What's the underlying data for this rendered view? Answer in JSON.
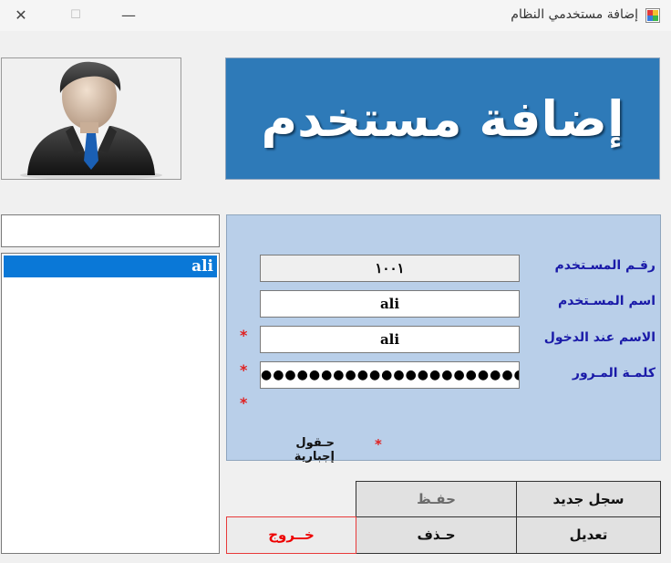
{
  "window": {
    "title": "إضافة مستخدمي النظام",
    "close_glyph": "✕",
    "maximize_glyph": "☐",
    "minimize_glyph": "—"
  },
  "header": {
    "banner_text": "إضافة مستخدم",
    "banner_color": "#2e7ab8",
    "avatar_icon": "user-avatar-icon"
  },
  "search": {
    "value": ""
  },
  "users_list": {
    "items": [
      {
        "label": "ali",
        "selected": true
      }
    ],
    "selection_color": "#0a78d7"
  },
  "form": {
    "panel_color": "#b9cfe9",
    "label_color": "#1a1aa8",
    "fields": {
      "user_id": {
        "label": "رقـم المسـتخدم",
        "value": "١٠٠١"
      },
      "user_name": {
        "label": "اسم المسـتخدم",
        "value": "ali"
      },
      "login_name": {
        "label": "الاسم عند الدخول",
        "value": "ali"
      },
      "password": {
        "label": "كلمـة المـرور",
        "value": "●●●●●●●●●●●●●●●●●●●●●●●●●●"
      }
    },
    "required_marker": "*",
    "required_color": "#e02020",
    "required_legend": "حـقول إجبارية"
  },
  "buttons": {
    "new": "سجل جديد",
    "save": "حفـظ",
    "edit": "تعديل",
    "delete": "حـذف",
    "exit": "خــروج",
    "exit_color": "#e00000"
  }
}
